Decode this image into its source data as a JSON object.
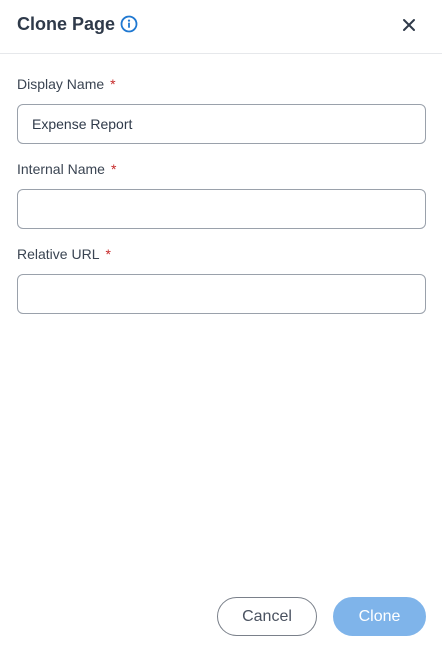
{
  "dialog": {
    "title": "Clone Page",
    "info_icon": "info-circle-icon",
    "close_icon": "close-x-icon"
  },
  "form": {
    "display_name": {
      "label": "Display Name",
      "required_marker": "*",
      "value": "Expense Report"
    },
    "internal_name": {
      "label": "Internal Name",
      "required_marker": "*",
      "value": ""
    },
    "relative_url": {
      "label": "Relative URL",
      "required_marker": "*",
      "value": ""
    }
  },
  "actions": {
    "cancel_label": "Cancel",
    "clone_label": "Clone",
    "clone_disabled": true
  },
  "colors": {
    "accent": "#1f78d1",
    "required": "#c62828",
    "clone_button_disabled": "#7fb4ea",
    "text_primary": "#2f3a4a"
  }
}
